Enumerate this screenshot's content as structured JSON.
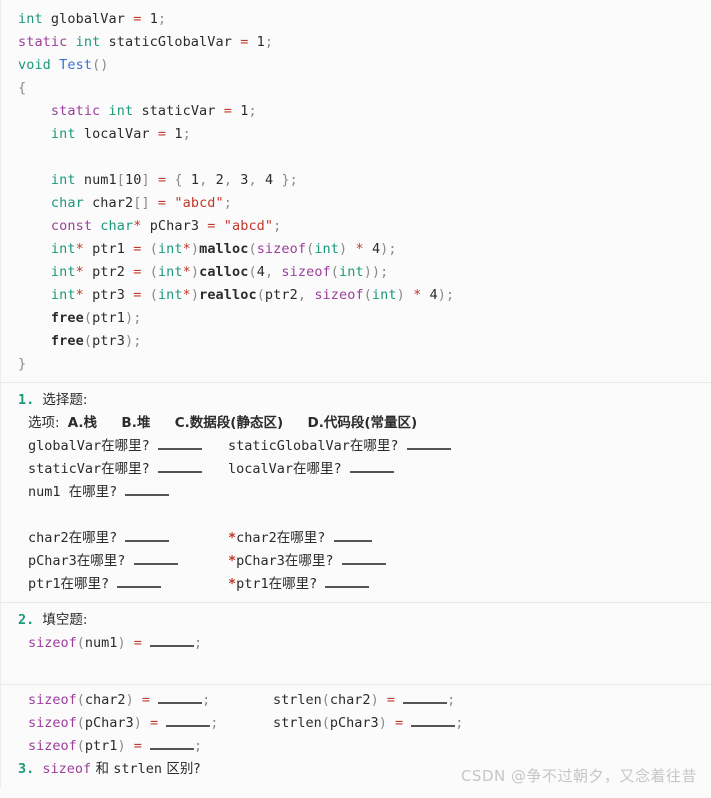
{
  "document": {
    "background_color": "#fbfbfb",
    "theme": {
      "keyword_color": "#1a9a7a",
      "static_color": "#9b3f9b",
      "function_color": "#3a6fd8",
      "operator_color": "#c0392b",
      "string_color": "#c0392b",
      "punctuation_color": "#8a8a8a",
      "identifier_color": "#2b2b2b",
      "list_number_color": "#1a9a7a"
    }
  },
  "code_block": {
    "language": "c",
    "lines": [
      "int globalVar = 1;",
      "static int staticGlobalVar = 1;",
      "void Test()",
      "{",
      "    static int staticVar = 1;",
      "    int localVar = 1;",
      "",
      "    int num1[10] = { 1, 2, 3, 4 };",
      "    char char2[] = \"abcd\";",
      "    const char* pChar3 = \"abcd\";",
      "    int* ptr1 = (int*)malloc(sizeof(int) * 4);",
      "    int* ptr2 = (int*)calloc(4, sizeof(int));",
      "    int* ptr3 = (int*)realloc(ptr2, sizeof(int) * 4);",
      "    free(ptr1);",
      "    free(ptr3);",
      "}"
    ]
  },
  "question1": {
    "number": "1.",
    "title": "选择题:",
    "options_label": "选项:",
    "options": [
      "A.栈",
      "B.堆",
      "C.数据段(静态区)",
      "D.代码段(常量区)"
    ],
    "options_line": "选项: A.栈   B.堆   C.数据段(静态区)   D.代码段(常量区)",
    "rows": [
      {
        "left": "globalVar在哪里?",
        "right": "staticGlobalVar在哪里?"
      },
      {
        "left": "staticVar在哪里?",
        "right": "localVar在哪里?"
      },
      {
        "left": "num1 在哪里?",
        "right": ""
      }
    ],
    "pointer_rows": [
      {
        "left": "char2在哪里?",
        "right": "*char2在哪里?"
      },
      {
        "left": "pChar3在哪里?",
        "right": "*pChar3在哪里?"
      },
      {
        "left": "ptr1在哪里?",
        "right": "*ptr1在哪里?"
      }
    ]
  },
  "question2": {
    "number": "2.",
    "title": "填空题:",
    "rows": [
      {
        "left": "sizeof(num1) = ____;",
        "right": ""
      },
      {
        "left": "sizeof(char2) = ____;",
        "right": "strlen(char2) = ____;"
      },
      {
        "left": "sizeof(pChar3) = ____;",
        "right": "strlen(pChar3) = ____;"
      },
      {
        "left": "sizeof(ptr1) = ____;",
        "right": ""
      }
    ]
  },
  "question3": {
    "number": "3.",
    "text_parts": [
      "sizeof",
      " 和 ",
      "strlen",
      " 区别?"
    ],
    "text": "sizeof 和 strlen 区别?"
  },
  "watermark": {
    "text": "CSDN @争不过朝夕，又念着往昔"
  }
}
